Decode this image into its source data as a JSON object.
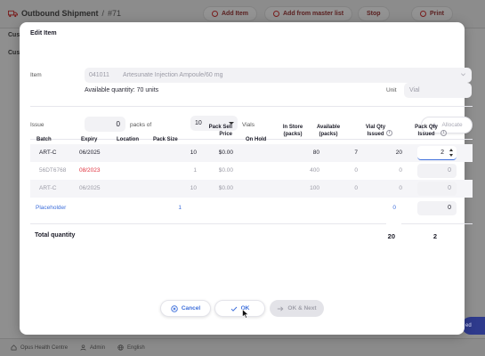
{
  "background": {
    "title": "Outbound Shipment",
    "title_sep": "/",
    "shipment_number": "#71",
    "buttons": [
      "Add Item",
      "Add from master list",
      "Stop",
      "Print"
    ],
    "sub_label_1": "Cus",
    "sub_label_2": "Cus",
    "right_button": "ed",
    "footer": {
      "store": "Opus Health Centre",
      "user": "Admin",
      "language": "English"
    }
  },
  "modal": {
    "title": "Edit Item",
    "item_label": "Item",
    "item_code": "041011",
    "item_name": "Artesunate Injection Ampoule/60 mg",
    "available_quantity": "Available quantity: 70 units",
    "unit_label": "Unit",
    "unit_value": "Vial",
    "issue_label": "Issue",
    "issue_value": "0",
    "packs_of_label": "packs of",
    "pack_size_value": "10",
    "vials_label": "Vials",
    "allocate_label": "Allocate"
  },
  "table": {
    "headers": {
      "batch": "Batch",
      "expiry": "Expiry",
      "location": "Location",
      "pack_size": "Pack Size",
      "pack_sell_price_1": "Pack Sell",
      "pack_sell_price_2": "Price",
      "on_hold": "On Hold",
      "in_store_1": "In Store",
      "in_store_2": "(packs)",
      "available_1": "Available",
      "available_2": "(packs)",
      "vial_qty_1": "Vial Qty",
      "vial_qty_2": "Issued",
      "pack_qty_1": "Pack Qty",
      "pack_qty_2": "Issued"
    },
    "rows": [
      {
        "batch": "ART-C",
        "expiry": "06/2025",
        "location": "",
        "pack_size": "10",
        "price": "$0.00",
        "on_hold": "",
        "in_store": "80",
        "available": "7",
        "vial_qty": "20",
        "pack_qty": "2"
      },
      {
        "batch": "56DT6768",
        "expiry": "08/2023",
        "location": "",
        "pack_size": "1",
        "price": "$0.00",
        "on_hold": "",
        "in_store": "400",
        "available": "0",
        "vial_qty": "0",
        "pack_qty": "0"
      },
      {
        "batch": "ART-C",
        "expiry": "06/2025",
        "location": "",
        "pack_size": "10",
        "price": "$0.00",
        "on_hold": "",
        "in_store": "100",
        "available": "0",
        "vial_qty": "0",
        "pack_qty": "0"
      }
    ],
    "placeholder": {
      "batch": "Placeholder",
      "pack_size": "1",
      "vial_qty": "0",
      "pack_qty": "0"
    },
    "total_label": "Total quantity",
    "total_vial": "20",
    "total_pack": "2"
  },
  "footer_buttons": {
    "cancel": "Cancel",
    "ok": "OK",
    "ok_next": "OK & Next"
  },
  "colors": {
    "accent": "#3e6fdb",
    "expired": "#e0323e",
    "brand_dark": "#7a1d1d"
  }
}
